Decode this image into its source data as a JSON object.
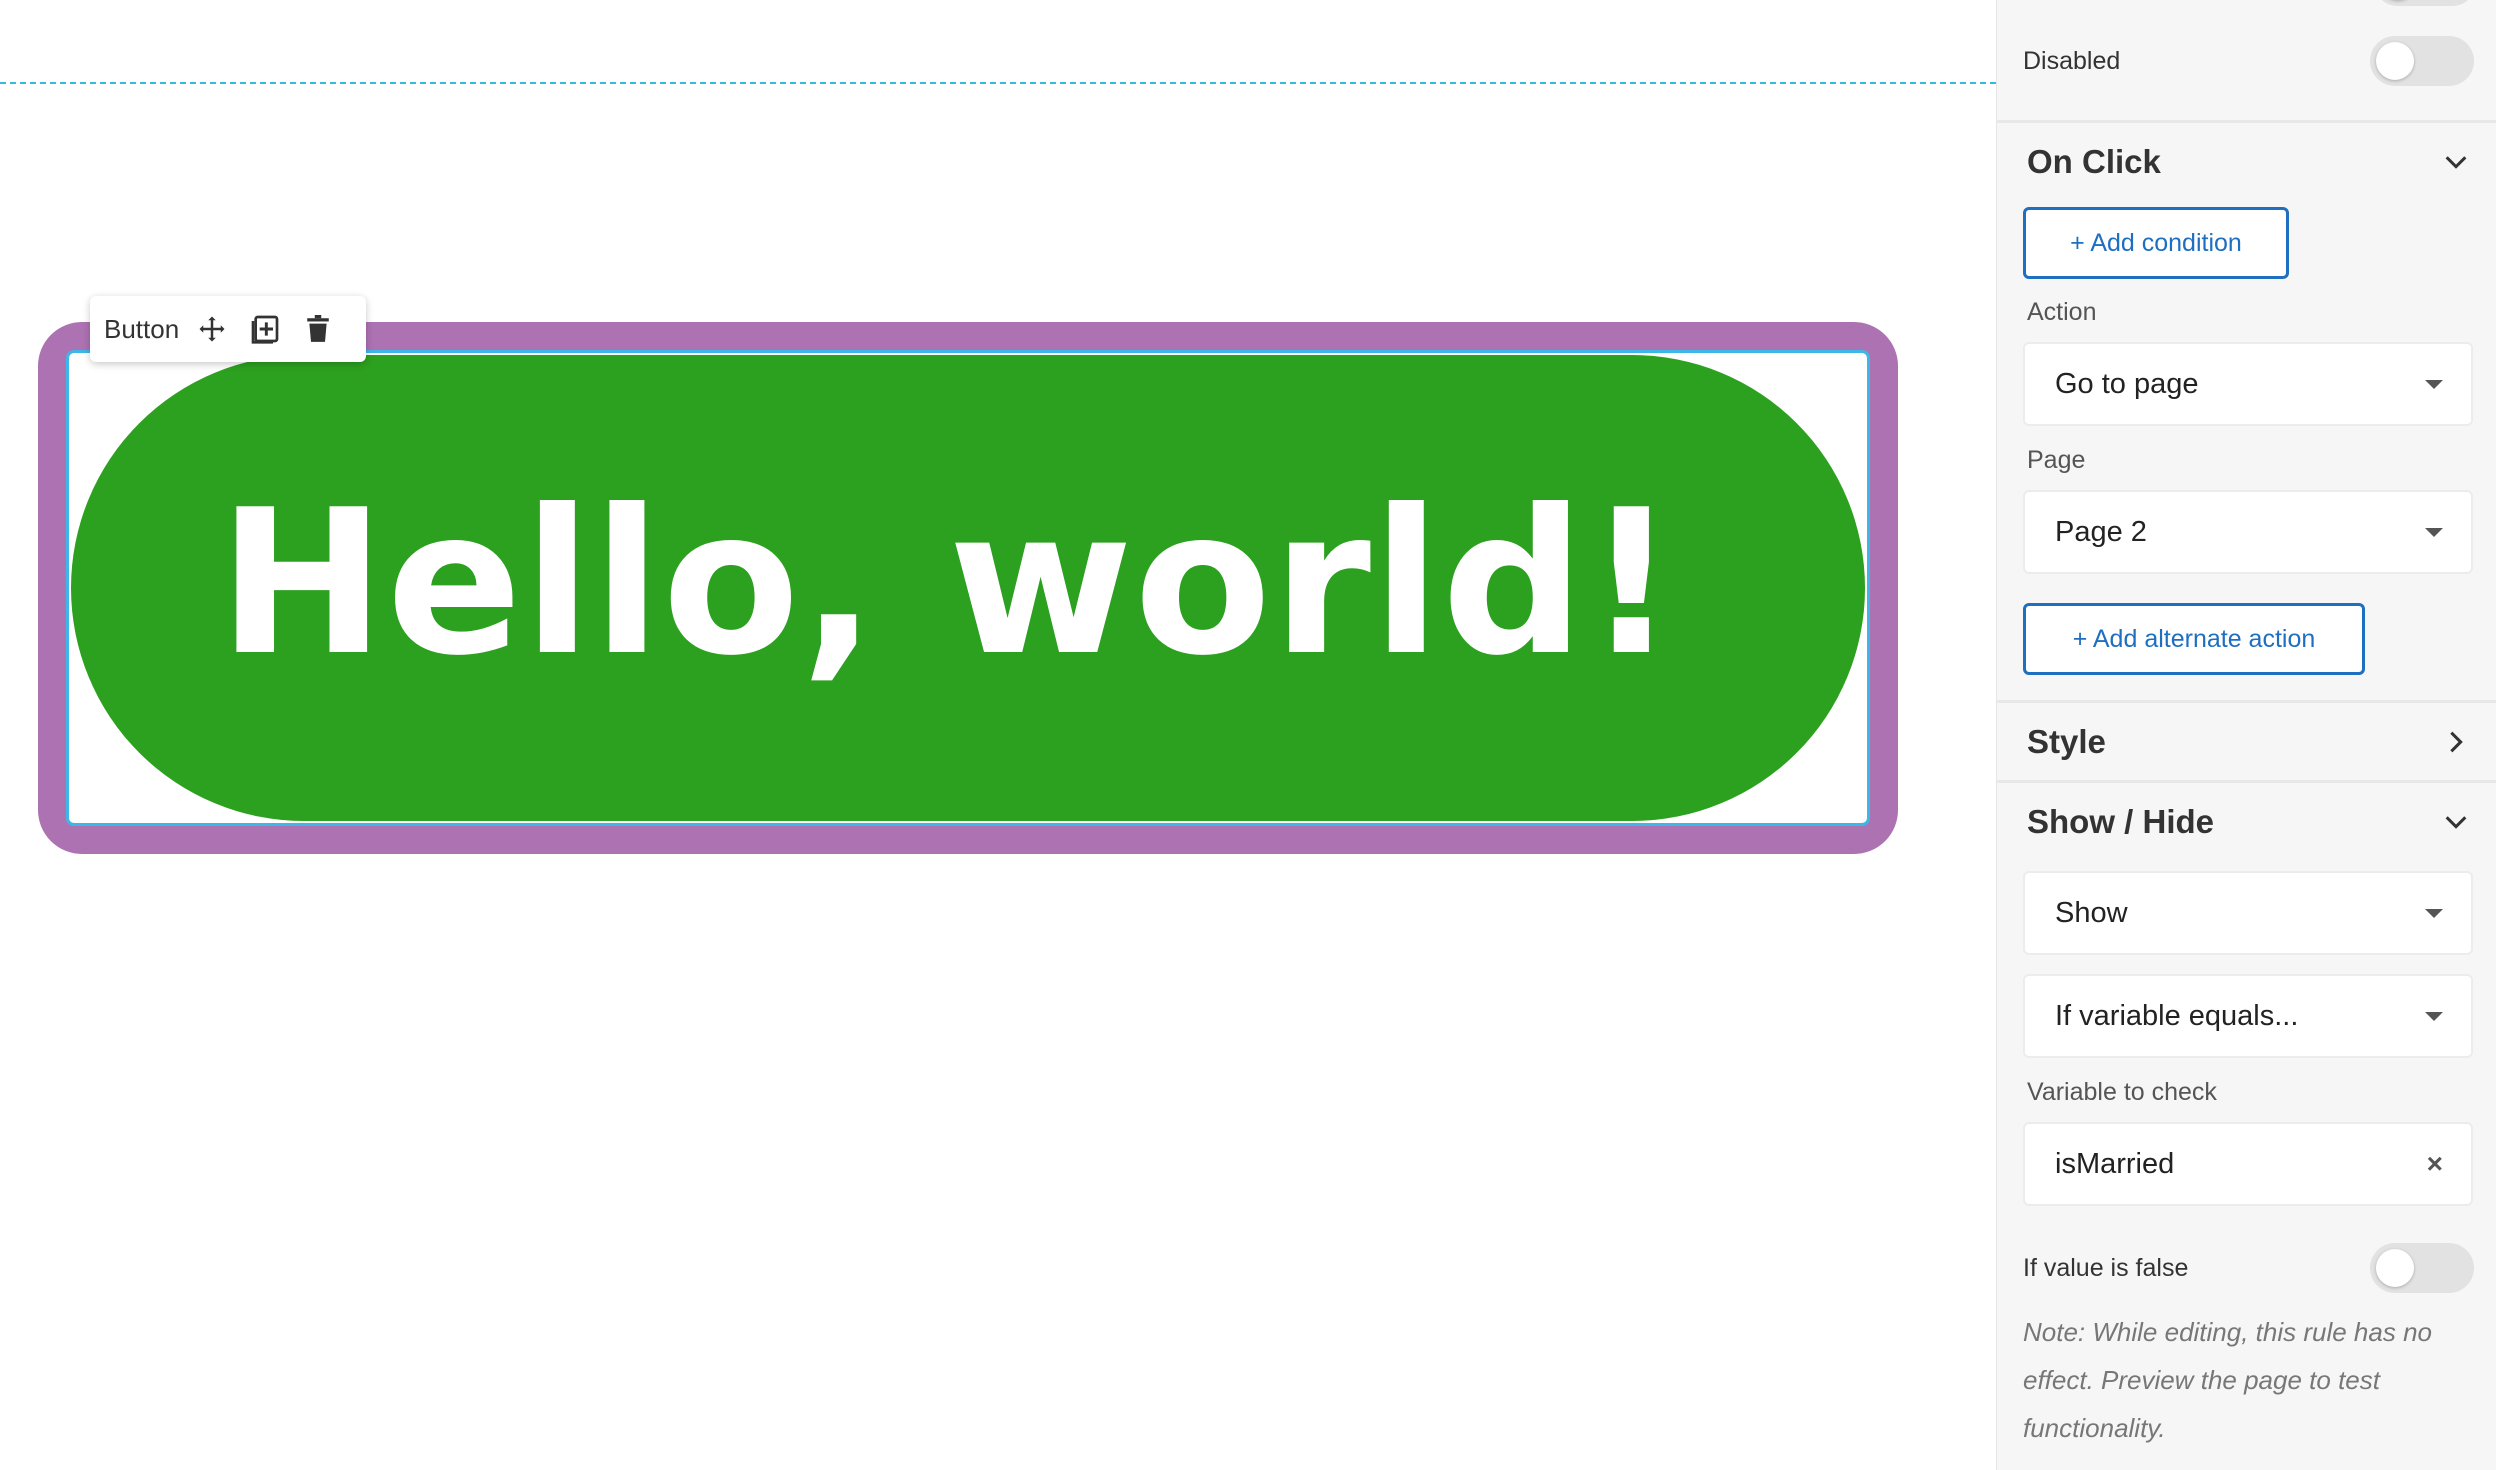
{
  "canvas": {
    "element_toolbar": {
      "label": "Button",
      "icons": [
        "move-icon",
        "duplicate-icon",
        "trash-icon"
      ]
    },
    "button_text": "Hello, world!",
    "colors": {
      "button_fill": "#2ca01f",
      "selection_outline": "#ad72b2",
      "guide_line": "#35b9dc"
    }
  },
  "panel": {
    "disabled_label": "Disabled",
    "on_click": {
      "title": "On Click",
      "add_condition": "+ Add condition",
      "action_label": "Action",
      "action_value": "Go to page",
      "page_label": "Page",
      "page_value": "Page 2",
      "add_alternate_action": "+ Add alternate action"
    },
    "style": {
      "title": "Style"
    },
    "show_hide": {
      "title": "Show / Hide",
      "mode_value": "Show",
      "condition_value": "If variable equals...",
      "variable_label": "Variable to check",
      "variable_value": "isMarried",
      "clear_symbol": "×",
      "if_false_label": "If value is false",
      "note": "Note: While editing, this rule has no effect. Preview the page to test functionality."
    },
    "colors": {
      "link_blue": "#1e6fc0"
    }
  }
}
